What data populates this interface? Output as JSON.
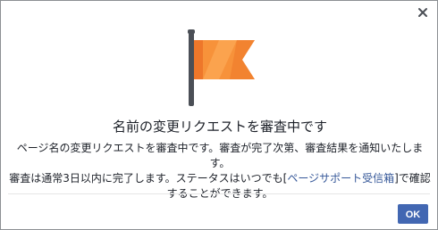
{
  "dialog": {
    "title": "名前の変更リクエストを審査中です",
    "body_line1": "ページ名の変更リクエストを審査中です。審査が完了次第、審査結果を通知いたします。",
    "body_line2_prefix": "審査は通常3日以内に完了します。ステータスはいつでも[",
    "link_text": "ページサポート受信箱",
    "body_line2_suffix": "]で確認",
    "body_line3": "することができます。",
    "ok_label": "OK"
  },
  "icons": {
    "close": "close-icon",
    "flag": "flag-icon"
  },
  "colors": {
    "flag_orange": "#f7923a",
    "flag_dark_orange": "#e8661f",
    "pole": "#4b4f56",
    "link": "#365899",
    "button": "#4267b2"
  }
}
